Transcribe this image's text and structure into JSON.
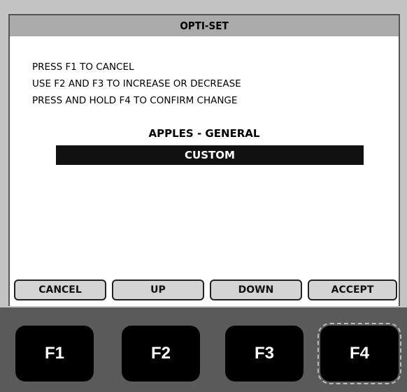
{
  "screen": {
    "title": "OPTI-SET",
    "instructions": [
      "PRESS F1 TO CANCEL",
      "USE F2 AND F3 TO INCREASE OR DECREASE",
      "PRESS AND HOLD F4 TO CONFIRM CHANGE"
    ],
    "product": "APPLES - GENERAL",
    "selected_setting": "CUSTOM"
  },
  "softkeys": [
    {
      "label": "CANCEL"
    },
    {
      "label": "UP"
    },
    {
      "label": "DOWN"
    },
    {
      "label": "ACCEPT"
    }
  ],
  "hardware_keys": [
    {
      "label": "F1"
    },
    {
      "label": "F2"
    },
    {
      "label": "F3"
    },
    {
      "label": "F4"
    }
  ],
  "colors": {
    "title_bar": "#aaaaaa",
    "selection_bar": "#111111",
    "bezel": "#5a5a5a",
    "key": "#000000"
  }
}
